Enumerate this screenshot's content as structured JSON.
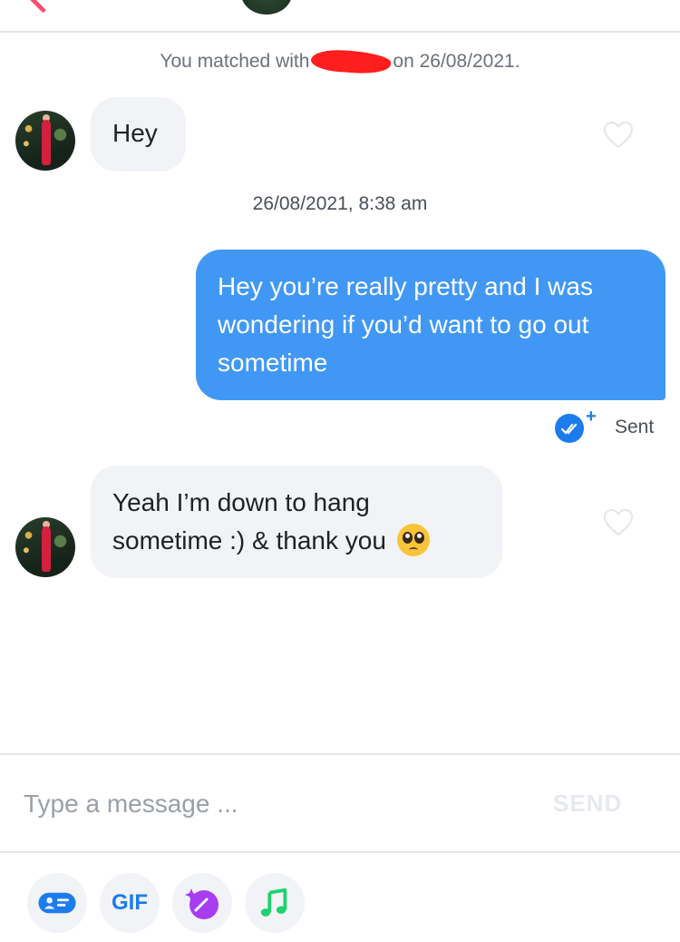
{
  "match_notice": {
    "prefix": "You matched with",
    "suffix": "on 26/08/2021."
  },
  "messages": [
    {
      "direction": "incoming",
      "text": "Hey"
    },
    {
      "timestamp": "26/08/2021, 8:38 am"
    },
    {
      "direction": "outgoing",
      "text": "Hey you’re really pretty and I was wondering if you’d want to go out sometime"
    },
    {
      "status": "Sent"
    },
    {
      "direction": "incoming",
      "text": "Yeah I’m down to hang sometime :) & thank you",
      "emoji": "pleading-face"
    }
  ],
  "composer": {
    "placeholder": "Type a message ...",
    "send_label": "SEND"
  },
  "toolbar": {
    "items": [
      "contact-card-icon",
      "GIF",
      "sparkle-sticker-icon",
      "music-note-icon"
    ],
    "gif_label": "GIF"
  },
  "colors": {
    "outgoing_bubble": "#4198f4",
    "incoming_bubble": "#f1f3f6",
    "accent_blue": "#1c7ced",
    "brand_pink": "#fd4e6b",
    "sticker_purple": "#a83cf0",
    "music_green": "#1ed26f"
  }
}
